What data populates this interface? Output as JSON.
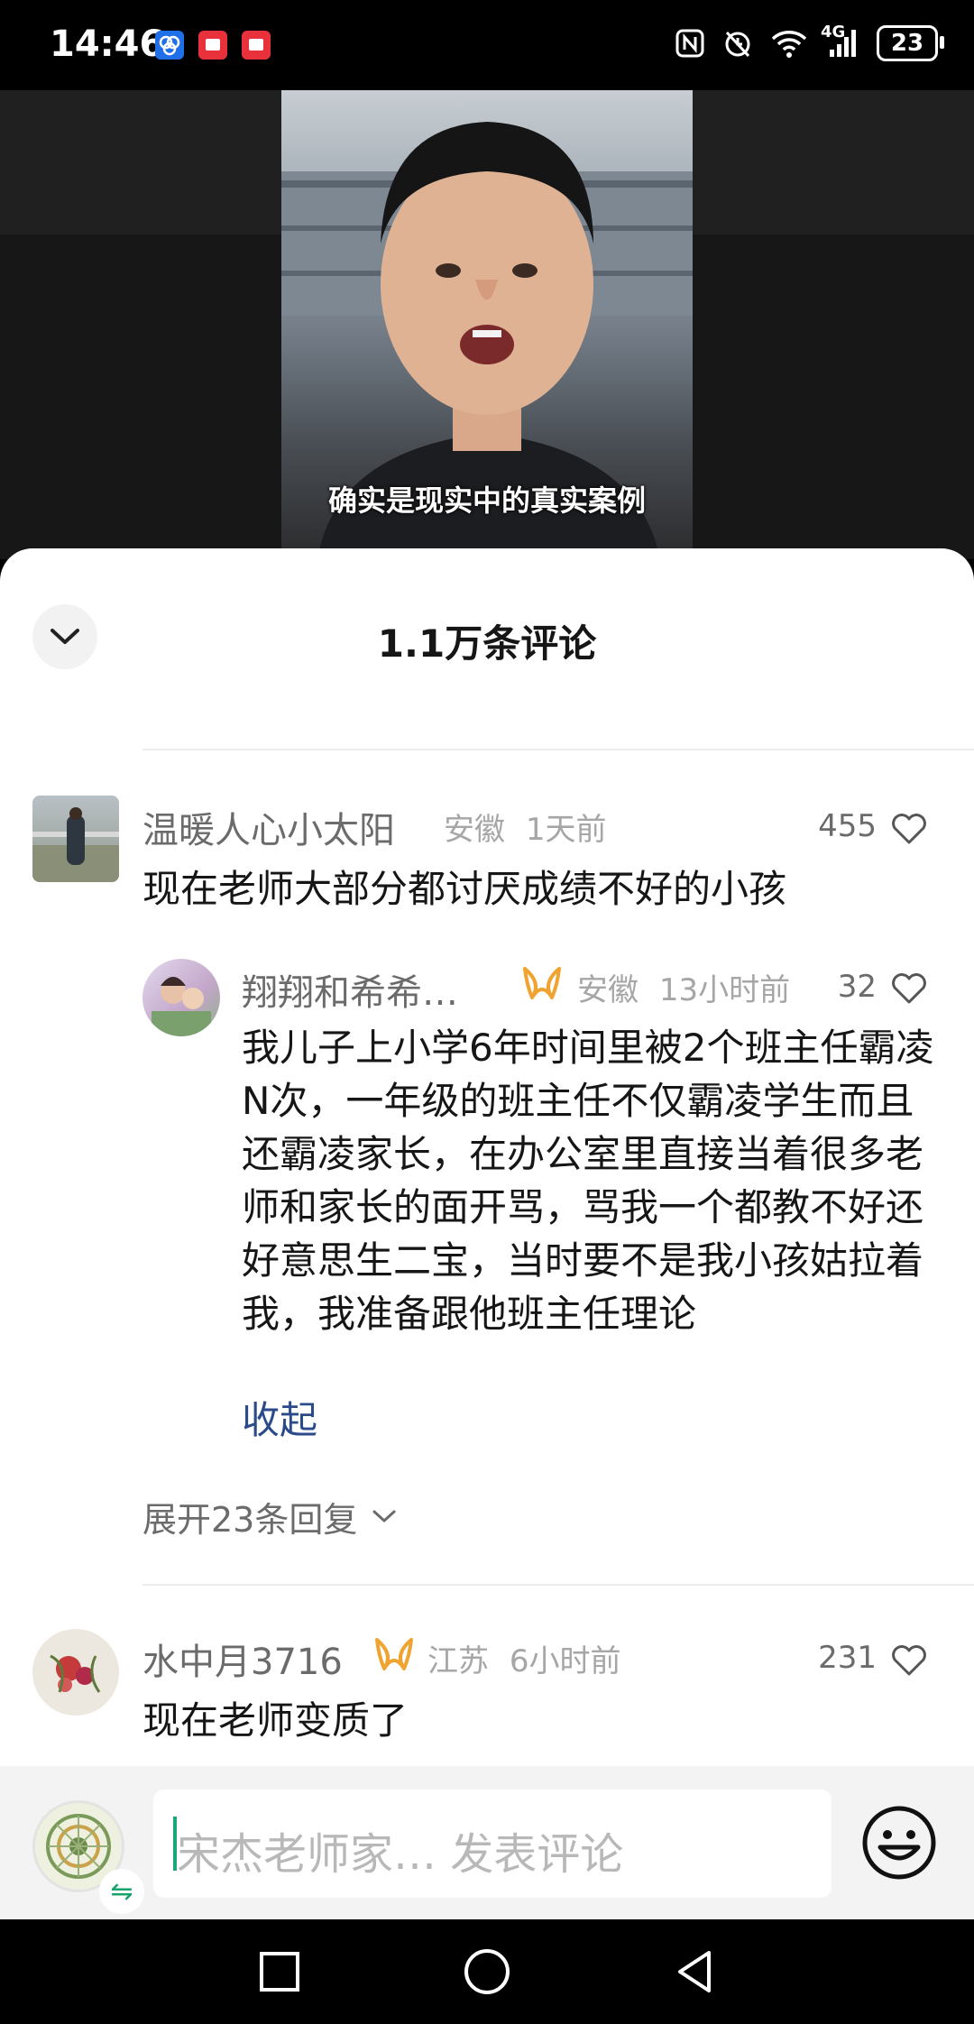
{
  "status_bar": {
    "time": "14:46",
    "network": "4G",
    "battery": "23"
  },
  "video": {
    "subtitle": "确实是现实中的真实案例"
  },
  "comments_panel": {
    "title": "1.1万条评论"
  },
  "comments": [
    {
      "username": "温暖人心小太阳",
      "location": "安徽",
      "time": "1天前",
      "likes": "455",
      "text": "现在老师大部分都讨厌成绩不好的小孩"
    },
    {
      "username": "水中月3716",
      "location": "江苏",
      "time": "6小时前",
      "likes": "231",
      "text": "现在老师变质了"
    }
  ],
  "reply": {
    "username": "翔翔和希希…",
    "location": "安徽",
    "time": "13小时前",
    "likes": "32",
    "text": "我儿子上小学6年时间里被2个班主任霸凌N次，一年级的班主任不仅霸凌学生而且还霸凌家长，在办公室里直接当着很多老师和家长的面开骂，骂我一个都教不好还好意思生二宝，当时要不是我小孩姑拉着我，我准备跟他班主任理论",
    "collapse_label": "收起"
  },
  "expand_replies": "展开23条回复",
  "input": {
    "placeholder": "宋杰老师家… 发表评论"
  },
  "colors": {
    "link": "#2b4a8a",
    "badge": "#f0a330",
    "caret": "#19a979"
  }
}
